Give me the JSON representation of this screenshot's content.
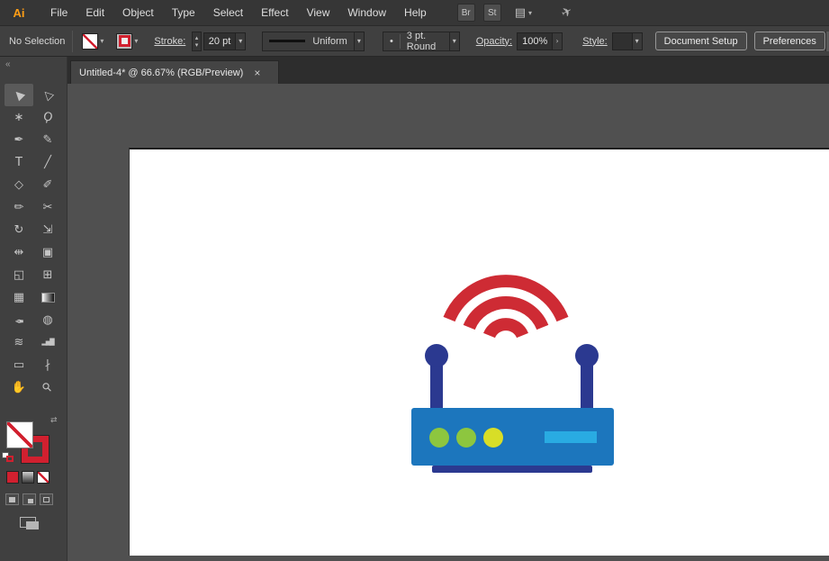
{
  "app": {
    "logo_label": "Ai",
    "bridge_label": "Br",
    "stock_label": "St"
  },
  "menus": [
    "File",
    "Edit",
    "Object",
    "Type",
    "Select",
    "Effect",
    "View",
    "Window",
    "Help"
  ],
  "icons": {
    "chevron_down": "▾",
    "chevron_right": "›",
    "stepper_up": "▴",
    "stepper_down": "▾",
    "collapse": "«",
    "swap": "⇄",
    "close": "×",
    "brush_dot": "•",
    "workspace": "▤",
    "gpu_rocket": "✈"
  },
  "control_bar": {
    "selection_status": "No Selection",
    "stroke_label": "Stroke:",
    "stroke_value": "20 pt",
    "width_profile": "Uniform",
    "brush_name": "3 pt. Round",
    "opacity_label": "Opacity:",
    "opacity_value": "100%",
    "style_label": "Style:",
    "document_setup_label": "Document Setup",
    "preferences_label": "Preferences"
  },
  "document_tab": {
    "title": "Untitled-4* @ 66.67% (RGB/Preview)"
  },
  "toolbar": {
    "tools": [
      {
        "name": "selection",
        "glyph": "▶"
      },
      {
        "name": "direct-selection",
        "glyph": "▷"
      },
      {
        "name": "magic-wand",
        "glyph": "∗"
      },
      {
        "name": "lasso",
        "glyph": "Ϙ"
      },
      {
        "name": "pen",
        "glyph": "✒"
      },
      {
        "name": "curvature",
        "glyph": "✎"
      },
      {
        "name": "type",
        "glyph": "T"
      },
      {
        "name": "line-segment",
        "glyph": "╱"
      },
      {
        "name": "polygon",
        "glyph": "◇"
      },
      {
        "name": "paintbrush",
        "glyph": "✐"
      },
      {
        "name": "pencil",
        "glyph": "✏"
      },
      {
        "name": "scissors",
        "glyph": "✂"
      },
      {
        "name": "rotate",
        "glyph": "↻"
      },
      {
        "name": "scale",
        "glyph": "⇲"
      },
      {
        "name": "width",
        "glyph": "⇹"
      },
      {
        "name": "free-transform",
        "glyph": "▣"
      },
      {
        "name": "shape-builder",
        "glyph": "◱"
      },
      {
        "name": "perspective-grid",
        "glyph": "⊞"
      },
      {
        "name": "mesh",
        "glyph": "▦"
      },
      {
        "name": "gradient",
        "glyph": ""
      },
      {
        "name": "eyedropper",
        "glyph": "✒"
      },
      {
        "name": "blend",
        "glyph": "◍"
      },
      {
        "name": "symbol-sprayer",
        "glyph": "≋"
      },
      {
        "name": "column-graph",
        "glyph": "▂▅█"
      },
      {
        "name": "artboard",
        "glyph": "▭"
      },
      {
        "name": "slice",
        "glyph": "∤"
      },
      {
        "name": "hand",
        "glyph": "✋"
      },
      {
        "name": "zoom",
        "glyph": "⚲"
      }
    ]
  },
  "swatch_state": {
    "fill": "none",
    "stroke_color": "#d1202f"
  },
  "artwork": {
    "name": "wifi-router-icon",
    "colors": {
      "signal_red": "#ce2b34",
      "body_blue": "#1c76bd",
      "antenna_navy": "#2b3990",
      "led_green": "#8dc63f",
      "led_yellow": "#d8de27",
      "panel_blue": "#29abe2"
    }
  }
}
